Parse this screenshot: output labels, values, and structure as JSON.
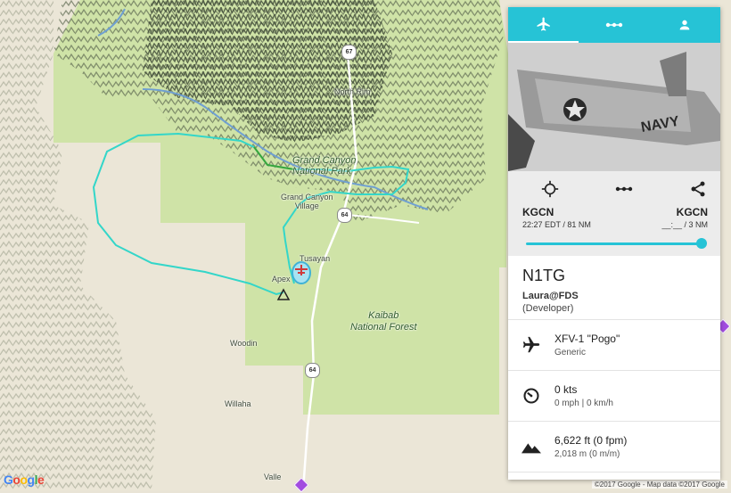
{
  "map": {
    "labels": {
      "north_rim": "North Rim",
      "park": "Grand Canyon National Park",
      "park_line1": "Grand Canyon",
      "park_line2": "National Park",
      "village_line1": "Grand Canyon",
      "village_line2": "Village",
      "tusayan": "Tusayan",
      "apex": "Apex",
      "forest_line1": "Kaibab",
      "forest_line2": "National Forest",
      "woodin": "Woodin",
      "willaha": "Willaha",
      "valle": "Valle"
    },
    "shields": {
      "r67": "67",
      "r64a": "64",
      "r64b": "64"
    },
    "google_logo": "Google",
    "copyright": "©2017 Google - Map data ©2017 Google",
    "track_color": "#33d6c9",
    "park_color": "#cfe3a7"
  },
  "panel": {
    "tabs": [
      {
        "icon": "airplane-icon",
        "active": true
      },
      {
        "icon": "route-icon",
        "active": false
      },
      {
        "icon": "person-icon",
        "active": false
      }
    ],
    "photo_alt": "NAVY",
    "route": {
      "origin_code": "KGCN",
      "origin_detail": "22:27 EDT / 81 NM",
      "dest_code": "KGCN",
      "dest_detail": "__:__ / 3 NM",
      "progress": 1.0
    },
    "flight": {
      "callsign": "N1TG",
      "pilot": "Laura@FDS",
      "role": "(Developer)"
    },
    "aircraft": {
      "model": "XFV-1 \"Pogo\"",
      "type": "Generic"
    },
    "speed": {
      "main": "0 kts",
      "sub": "0 mph | 0 km/h"
    },
    "altitude": {
      "main": "6,622 ft (0 fpm)",
      "sub": "2,018 m (0 m/m)"
    },
    "accent": "#26c3d6"
  }
}
